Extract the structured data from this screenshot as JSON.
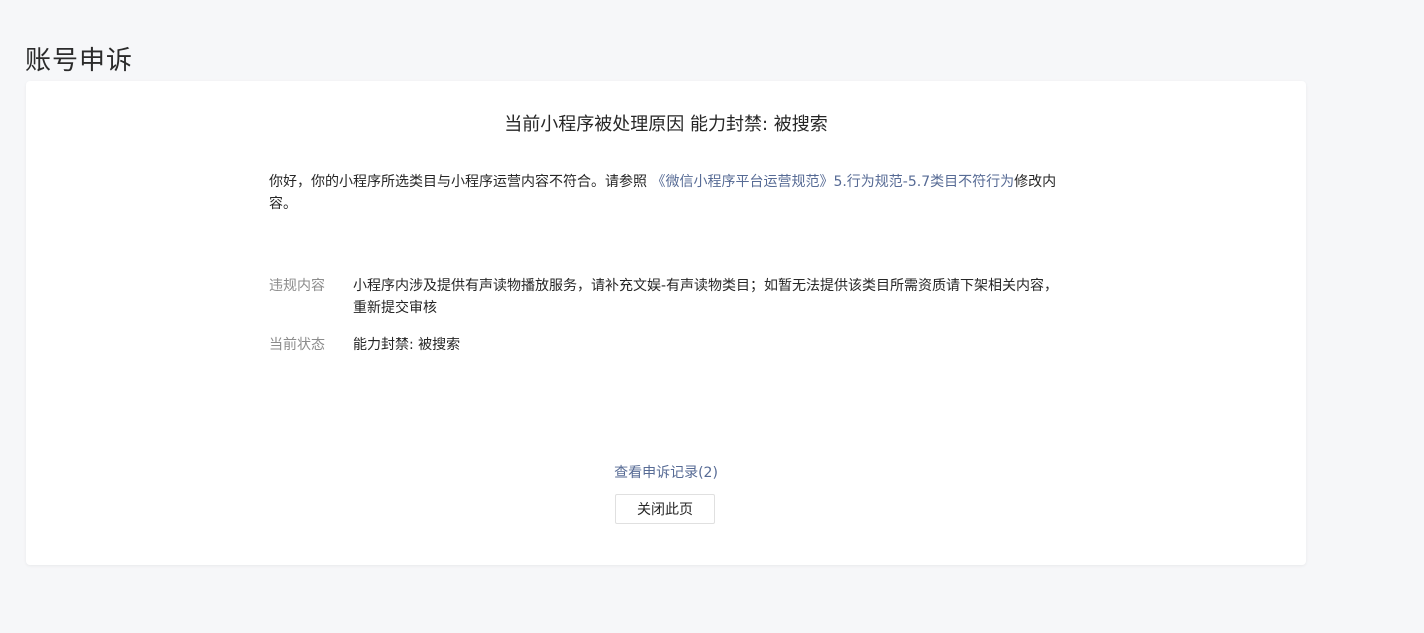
{
  "page": {
    "title": "账号申诉"
  },
  "card": {
    "heading": "当前小程序被处理原因 能力封禁: 被搜索",
    "intro": {
      "text_before": "你好，你的小程序所选类目与小程序运营内容不符合。请参照 ",
      "link_text": "《微信小程序平台运营规范》5.行为规范-5.7类目不符行为",
      "text_after": "修改内容。"
    },
    "violation": {
      "label": "违规内容",
      "value": "小程序内涉及提供有声读物播放服务，请补充文娱-有声读物类目；如暂无法提供该类目所需资质请下架相关内容，重新提交审核"
    },
    "status": {
      "label": "当前状态",
      "value": "能力封禁: 被搜索"
    },
    "records_link": "查看申诉记录(2)",
    "close_button": "关闭此页"
  },
  "colors": {
    "background": "#f6f7f9",
    "card": "#ffffff",
    "link": "#576b95",
    "label": "#8c8c8c"
  }
}
